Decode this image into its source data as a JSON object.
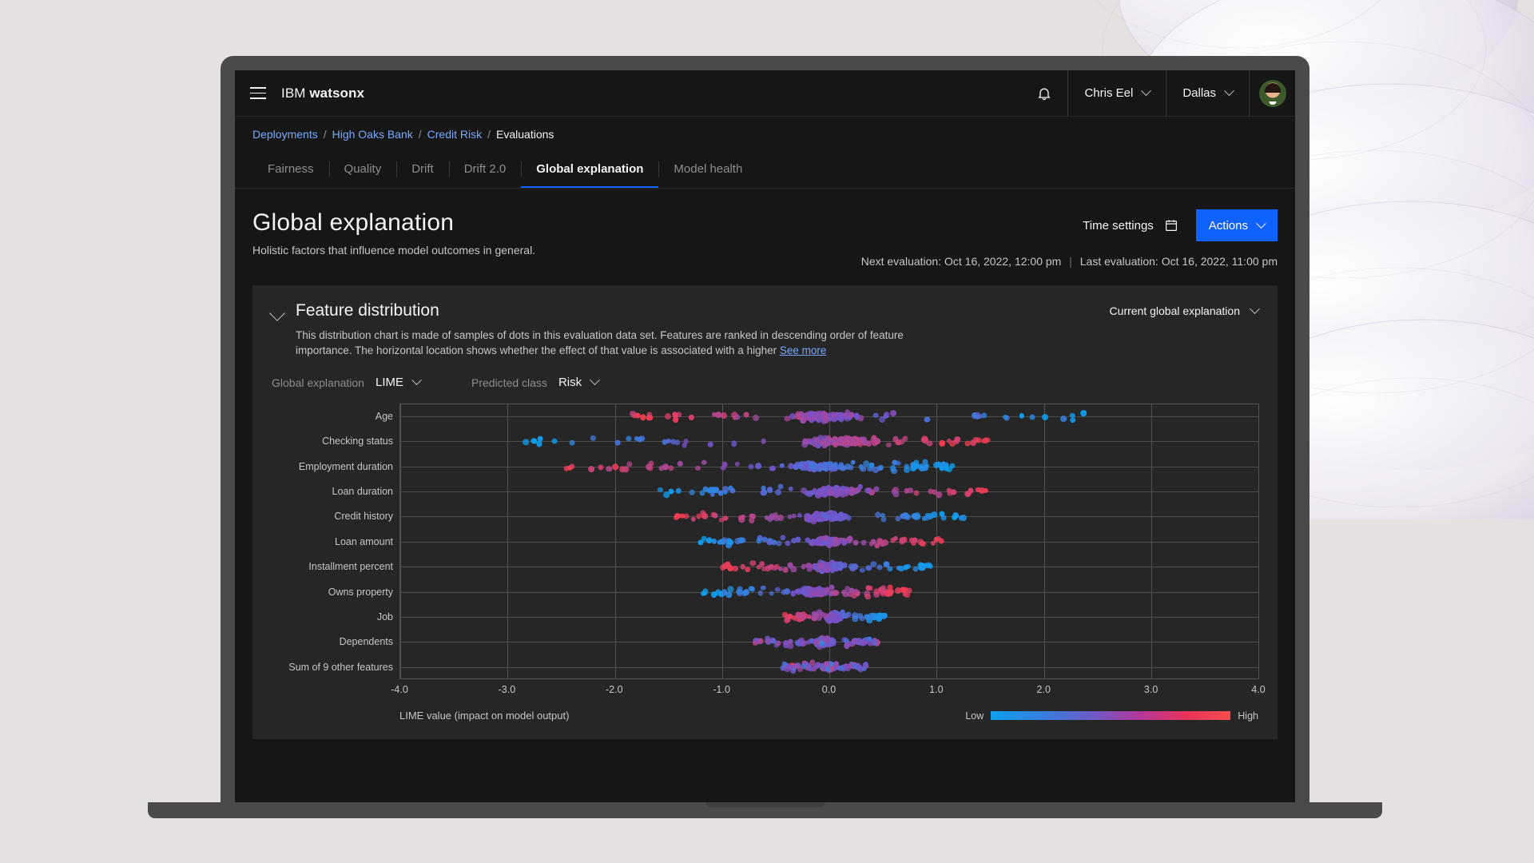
{
  "header": {
    "menu_icon": "hamburger-icon",
    "brand_prefix": "IBM",
    "brand_name": "watsonx",
    "notification_icon": "bell-icon",
    "user_name": "Chris Eel",
    "region": "Dallas",
    "avatar": "user-avatar"
  },
  "breadcrumb": {
    "items": [
      {
        "label": "Deployments",
        "link": true
      },
      {
        "label": "High Oaks Bank",
        "link": true
      },
      {
        "label": "Credit Risk",
        "link": true
      },
      {
        "label": "Evaluations",
        "link": false
      }
    ],
    "separator": "/"
  },
  "tabs": [
    {
      "label": "Fairness",
      "active": false
    },
    {
      "label": "Quality",
      "active": false
    },
    {
      "label": "Drift",
      "active": false
    },
    {
      "label": "Drift 2.0",
      "active": false
    },
    {
      "label": "Global explanation",
      "active": true
    },
    {
      "label": "Model health",
      "active": false
    }
  ],
  "page": {
    "title": "Global explanation",
    "subtitle": "Holistic factors that influence model outcomes in general.",
    "time_settings_label": "Time settings",
    "calendar_icon": "calendar-icon",
    "actions_label": "Actions",
    "next_evaluation": "Next evaluation: Oct 16, 2022, 12:00 pm",
    "separator": "|",
    "last_evaluation": "Last evaluation: Oct 16, 2022, 11:00 pm"
  },
  "card": {
    "title": "Feature distribution",
    "description_1": "This distribution chart is made of samples of dots in this evaluation data set. Features are ranked in descending order of",
    "description_2": "feature importance. The horizontal location shows whether the effect of that value is associated with a higher ",
    "see_more": "See more",
    "scope_selector": "Current global explanation",
    "selectors": [
      {
        "label": "Global explanation",
        "value": "LIME"
      },
      {
        "label": "Predicted class",
        "value": "Risk"
      }
    ]
  },
  "colors": {
    "accent": "#0f62fe",
    "link": "#78a9ff",
    "card_bg": "#262626",
    "page_bg": "#161616",
    "low": "#0d9ff0",
    "high": "#fa4d4d"
  },
  "chart_data": {
    "type": "scatter",
    "title": "Feature distribution",
    "xlabel": "LIME value (impact on model output)",
    "ylabel": "",
    "xlim": [
      -4.0,
      4.0
    ],
    "xticks": [
      "-4.0",
      "-3.0",
      "-2.0",
      "-1.0",
      "0.0",
      "1.0",
      "2.0",
      "3.0",
      "4.0"
    ],
    "grid": true,
    "legend": {
      "position": "bottom-right",
      "low_label": "Low",
      "high_label": "High",
      "colormap": "blue-to-red"
    },
    "categories": [
      "Age",
      "Checking status",
      "Employment duration",
      "Loan duration",
      "Credit history",
      "Loan amount",
      "Installment percent",
      "Owns property",
      "Job",
      "Dependents",
      "Sum of 9 other features"
    ],
    "series": [
      {
        "name": "Age",
        "x_range": [
          -1.95,
          2.6
        ],
        "density_center": -0.05,
        "color_bias": "mixed-red-left-blue-right",
        "n": 150
      },
      {
        "name": "Checking status",
        "x_range": [
          -2.85,
          1.5
        ],
        "density_center": 0.1,
        "color_bias": "blue-left-red-right",
        "n": 150
      },
      {
        "name": "Employment duration",
        "x_range": [
          -2.5,
          1.15
        ],
        "density_center": -0.1,
        "color_bias": "red-left-blue-right",
        "n": 150
      },
      {
        "name": "Loan duration",
        "x_range": [
          -1.7,
          1.55
        ],
        "density_center": 0.05,
        "color_bias": "blue-left-red-right",
        "n": 150
      },
      {
        "name": "Credit history",
        "x_range": [
          -1.45,
          1.25
        ],
        "density_center": -0.05,
        "color_bias": "red-left-blue-right",
        "n": 150
      },
      {
        "name": "Loan amount",
        "x_range": [
          -1.25,
          1.05
        ],
        "density_center": 0.0,
        "color_bias": "blue-left-red-right",
        "n": 150
      },
      {
        "name": "Installment percent",
        "x_range": [
          -1.0,
          0.95
        ],
        "density_center": 0.0,
        "color_bias": "red-left-blue-right",
        "n": 150
      },
      {
        "name": "Owns property",
        "x_range": [
          -1.2,
          0.75
        ],
        "density_center": -0.15,
        "color_bias": "blue-left-red-right",
        "n": 150
      },
      {
        "name": "Job",
        "x_range": [
          -0.45,
          0.55
        ],
        "density_center": 0.05,
        "color_bias": "red-left-blue-right",
        "n": 150
      },
      {
        "name": "Dependents",
        "x_range": [
          -0.7,
          0.45
        ],
        "density_center": -0.05,
        "color_bias": "mixed",
        "n": 150
      },
      {
        "name": "Sum of 9 other features",
        "x_range": [
          -0.45,
          0.35
        ],
        "density_center": 0.0,
        "color_bias": "mixed",
        "n": 150
      }
    ]
  }
}
